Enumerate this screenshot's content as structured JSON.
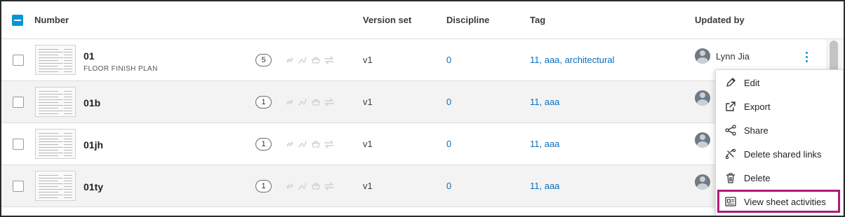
{
  "columns": {
    "number": "Number",
    "version_set": "Version set",
    "discipline": "Discipline",
    "tag": "Tag",
    "updated_by": "Updated by"
  },
  "rows": [
    {
      "number": "01",
      "title": "FLOOR FINISH PLAN",
      "version_count": "5",
      "version_set": "v1",
      "discipline": "0",
      "tags": [
        "11",
        "aaa",
        "architectural"
      ],
      "updated_by": "Lynn Jia"
    },
    {
      "number": "01b",
      "title": "",
      "version_count": "1",
      "version_set": "v1",
      "discipline": "0",
      "tags": [
        "11",
        "aaa"
      ],
      "updated_by": ""
    },
    {
      "number": "01jh",
      "title": "",
      "version_count": "1",
      "version_set": "v1",
      "discipline": "0",
      "tags": [
        "11",
        "aaa"
      ],
      "updated_by": ""
    },
    {
      "number": "01ty",
      "title": "",
      "version_count": "1",
      "version_set": "v1",
      "discipline": "0",
      "tags": [
        "11",
        "aaa"
      ],
      "updated_by": ""
    }
  ],
  "tag_separator": ", ",
  "context_menu": {
    "items": [
      {
        "label": "Edit",
        "icon": "pencil-icon"
      },
      {
        "label": "Export",
        "icon": "export-icon"
      },
      {
        "label": "Share",
        "icon": "share-icon"
      },
      {
        "label": "Delete shared links",
        "icon": "unlink-icon"
      },
      {
        "label": "Delete",
        "icon": "trash-icon"
      },
      {
        "label": "View sheet activities",
        "icon": "activity-log-icon"
      }
    ],
    "highlighted_item": "View sheet activities"
  },
  "colors": {
    "accent": "#0696d7",
    "link": "#0a6ebd",
    "highlight_border": "#b01b77",
    "alt_row": "#f3f3f3"
  }
}
